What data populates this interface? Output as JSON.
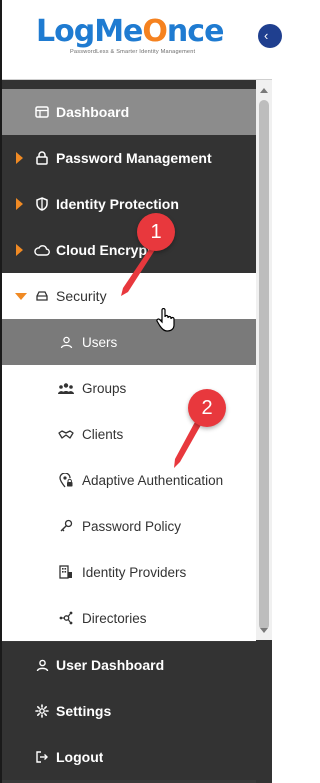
{
  "logo": {
    "brand_part1": "LogMe",
    "brand_o": "O",
    "brand_part2": "nce",
    "tagline": "PasswordLess & Smarter Identity Management"
  },
  "collapse_button": {
    "symbol": "‹"
  },
  "sidebar": {
    "dashboard": "Dashboard",
    "password_management": "Password Management",
    "identity_protection": "Identity Protection",
    "cloud_encryption": "Cloud Encrypt",
    "security": "Security",
    "security_sub": [
      {
        "label": "Users",
        "icon": "user-icon"
      },
      {
        "label": "Groups",
        "icon": "groups-icon"
      },
      {
        "label": "Clients",
        "icon": "handshake-icon"
      },
      {
        "label": "Adaptive Authentication",
        "icon": "location-lock-icon"
      },
      {
        "label": "Password Policy",
        "icon": "key-icon"
      },
      {
        "label": "Identity Providers",
        "icon": "building-icon"
      },
      {
        "label": "Directories",
        "icon": "network-icon"
      }
    ],
    "user_dashboard": "User Dashboard",
    "settings": "Settings",
    "logout": "Logout"
  },
  "annotations": [
    {
      "number": "1"
    },
    {
      "number": "2"
    }
  ],
  "colors": {
    "accent_orange": "#f08a24",
    "brand_blue": "#1f7bd1",
    "annotation_red": "#e8383d"
  }
}
